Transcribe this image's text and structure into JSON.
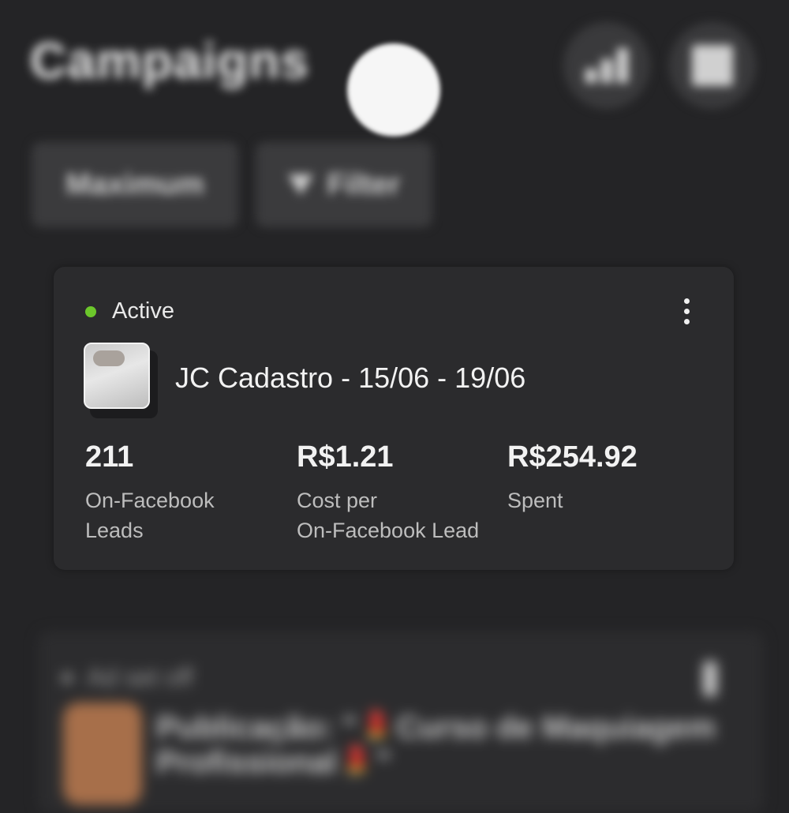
{
  "header": {
    "title": "Campaigns",
    "chart_icon": "bar-chart-icon",
    "grid_icon": "grid-icon"
  },
  "controls": {
    "time_pill_label": "Maximum",
    "filter_label": "Filter",
    "filter_icon": "funnel-icon"
  },
  "campaign_card": {
    "status": "Active",
    "status_color": "#6cc72b",
    "name": "JC Cadastro - 15/06 - 19/06",
    "metrics": [
      {
        "value": "211",
        "label_line1": "On-Facebook",
        "label_line2": "Leads"
      },
      {
        "value": "R$1.21",
        "label_line1": "Cost per",
        "label_line2": "On-Facebook Lead"
      },
      {
        "value": "R$254.92",
        "label_line1": "Spent",
        "label_line2": ""
      }
    ]
  },
  "adset_card": {
    "status": "Ad set off",
    "post_title": "Publicação: \"💄Curso de Maquiagem Profissional💄\""
  }
}
